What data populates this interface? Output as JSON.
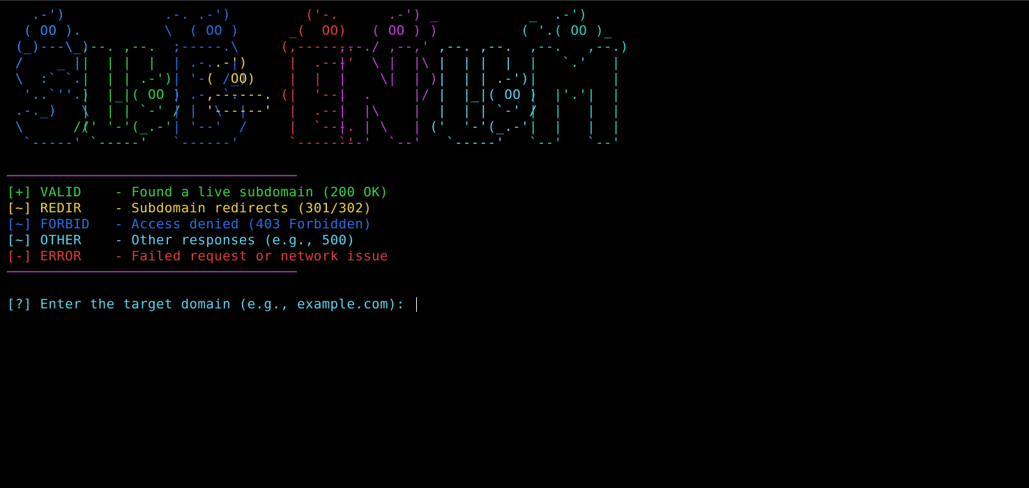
{
  "colors": {
    "background": "#000000",
    "red": "#e23c3c",
    "yellow": "#f0d23c",
    "green": "#33d44a",
    "blue": "#2b6ee8",
    "cyan": "#5fd3f0",
    "magenta": "#c03fd6"
  },
  "banner": {
    "blocks": [
      {
        "color": "#2b8cf0",
        "text": "   .-')\n  ( OO ).\n (_)---\\_)\n /    _ |\n \\  :` `.\n  '..`''.)\n .-._)   \\\n \\       /\n  `-----'"
      },
      {
        "color": "#33d44a",
        "text": "\n\n         ,--. ,--.\n         |  | |  |\n         |  | | .-')\n         |  |_|( OO )\n         |  | | `-' /\n        /(' '-'(_.-'\n          `-----'"
      },
      {
        "color": "#2b6ee8",
        "text": "                   .-. .-')\n                   \\  ( OO )\n                    ;-----.\\\n                    | .-.  |\n                    | '-' /_)\n                    | .-. `.\n                    | |  \\  |\n                    | '--'  /\n                    `------'"
      },
      {
        "color": "#f0d23c",
        "text": "\n\n\n                         .-')\n                        (  OO)\n                        ,------.\n                        '------'"
      },
      {
        "color": "#e23c3c",
        "text": "                                    ('-.\n                                  _(  OO)\n                                 (,------.\n                                  |  .---'\n                                  |  |\n                                 (|  '--.\n                                  |  .--'\n                                  |  `---.\n                                  `------'"
      },
      {
        "color": "#c03fd6",
        "text": "                                              .-') _\n                                            ( OO ) )\n                                        ,--./ ,--,'\n                                        |   \\ |  |\\\n                                        |    \\|  | )\n                                        |  .     |/\n                                        |  |\\    |\n                                        |  | \\   |\n                                        `--'  `--'"
      },
      {
        "color": "#5fd3f0",
        "text": "\n\n                                                    ,--. ,--.\n                                                    |  | |  |\n                                                    |  | | .-')\n                                                    |  |_|( OO )\n                                                    |  | | `-' /\n                                                   ('  '-'(_.-'\n                                                     `-----'"
      },
      {
        "color": "#2bd3c3",
        "text": "                                                               _  .-')\n                                                              ( '.( OO )_\n                                                               ,--.   ,--.)\n                                                               |   `.'   |\n                                                               |         |\n                                                               |  |'.'|  |\n                                                               |  |   |  |\n                                                               |  |   |  |\n                                                               `--'   `--'"
      }
    ]
  },
  "separator": "───────────────────────────────────",
  "legend": [
    {
      "tag": "[+]",
      "label": "VALID ",
      "desc": "- Found a live subdomain (200 OK)",
      "color": "#33d44a"
    },
    {
      "tag": "[~]",
      "label": "REDIR ",
      "desc": "- Subdomain redirects (301/302)",
      "color": "#f0d23c"
    },
    {
      "tag": "[~]",
      "label": "FORBID",
      "desc": "- Access denied (403 Forbidden)",
      "color": "#2b6ee8"
    },
    {
      "tag": "[~]",
      "label": "OTHER ",
      "desc": "- Other responses (e.g., 500)",
      "color": "#5fd3f0"
    },
    {
      "tag": "[-]",
      "label": "ERROR ",
      "desc": "- Failed request or network issue",
      "color": "#e23c3c"
    }
  ],
  "prompt": {
    "text": "[?] Enter the target domain (e.g., example.com): ",
    "value": "",
    "color": "#5fd3f0"
  }
}
